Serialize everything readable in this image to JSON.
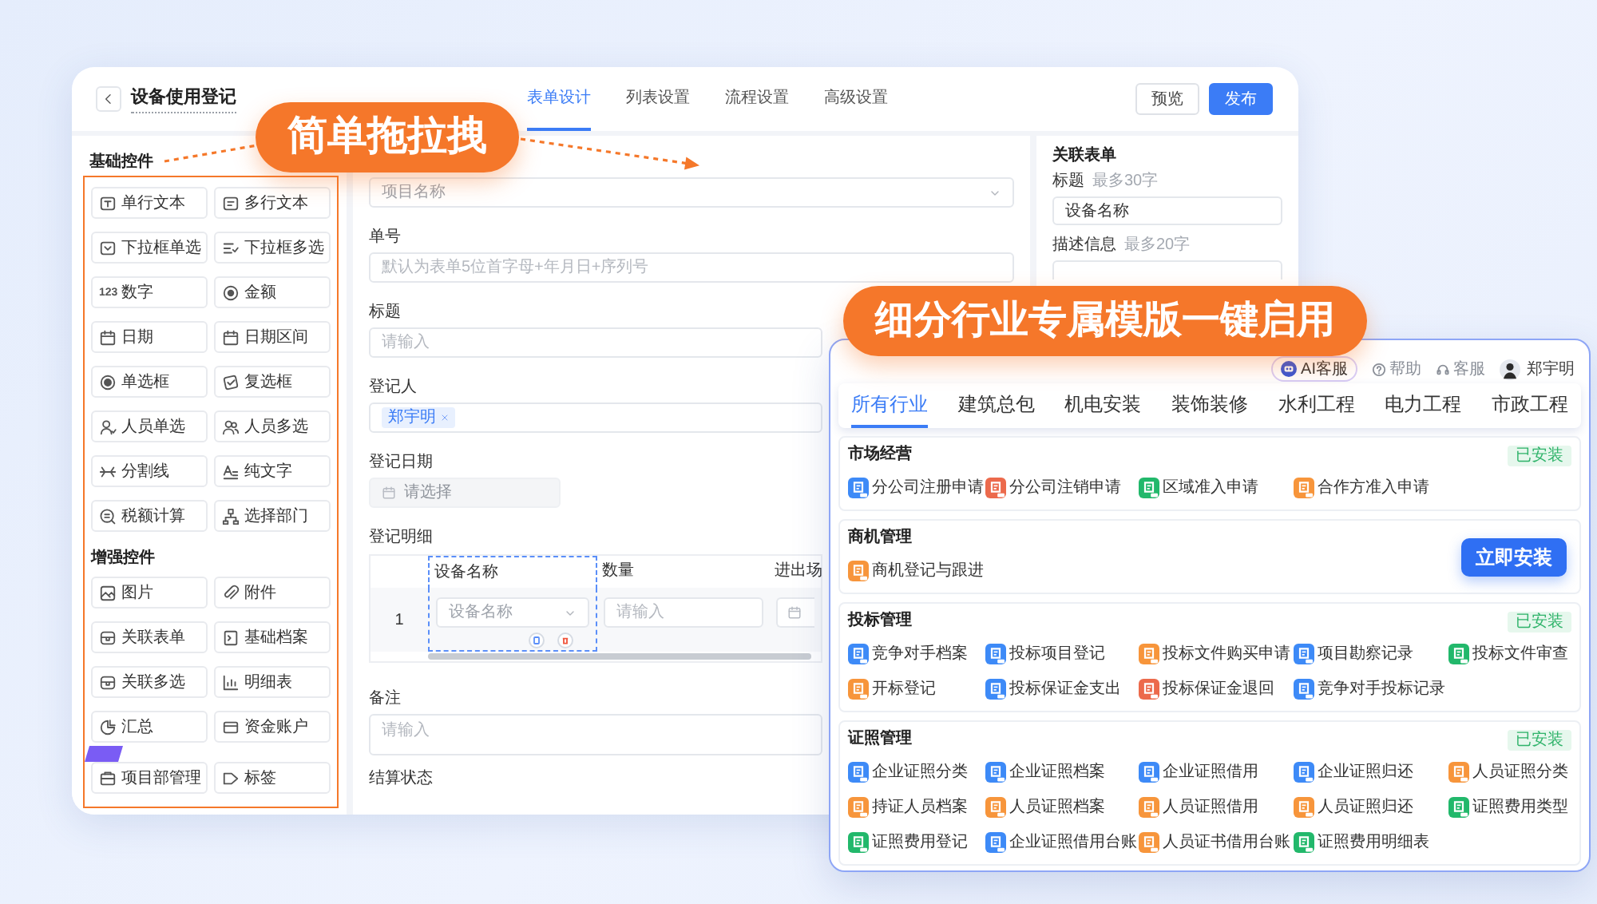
{
  "editor": {
    "title": "设备使用登记",
    "tabs": [
      {
        "label": "表单设计",
        "selected": true
      },
      {
        "label": "列表设置",
        "selected": false
      },
      {
        "label": "流程设置",
        "selected": false
      },
      {
        "label": "高级设置",
        "selected": false
      }
    ],
    "buttons": [
      {
        "label": "预览",
        "kind": "secondary"
      },
      {
        "label": "发布",
        "kind": "primary"
      }
    ],
    "palette": [
      {
        "title": "基础控件",
        "items": [
          {
            "label": "单行文本"
          },
          {
            "label": "多行文本"
          },
          {
            "label": "下拉框单选"
          },
          {
            "label": "下拉框多选"
          },
          {
            "label": "数字",
            "glyph": "123"
          },
          {
            "label": "金额"
          },
          {
            "label": "日期"
          },
          {
            "label": "日期区间"
          },
          {
            "label": "单选框"
          },
          {
            "label": "复选框"
          },
          {
            "label": "人员单选"
          },
          {
            "label": "人员多选"
          },
          {
            "label": "分割线"
          },
          {
            "label": "纯文字"
          },
          {
            "label": "税额计算"
          },
          {
            "label": "选择部门"
          }
        ]
      },
      {
        "title": "增强控件",
        "items": [
          {
            "label": "图片"
          },
          {
            "label": "附件"
          },
          {
            "label": "关联表单"
          },
          {
            "label": "基础档案"
          },
          {
            "label": "关联多选"
          },
          {
            "label": "明细表"
          },
          {
            "label": "汇总"
          },
          {
            "label": "资金账户"
          },
          {
            "label": "项目部管理",
            "badge": true
          },
          {
            "label": "标签"
          }
        ]
      }
    ],
    "form": [
      {
        "kind": "select",
        "placeholder": "项目名称"
      },
      {
        "kind": "input",
        "label": "单号",
        "placeholder": "默认为表单5位首字母+年月日+序列号"
      },
      {
        "kind": "input",
        "label": "标题",
        "placeholder": "请输入"
      },
      {
        "kind": "people",
        "label": "登记人",
        "tags": [
          "郑宇明"
        ]
      },
      {
        "kind": "date",
        "label": "登记日期",
        "placeholder": "请选择",
        "disabled": true
      },
      {
        "kind": "table",
        "label": "登记明细",
        "columns": [
          {
            "title": "设备名称",
            "selected": true
          },
          {
            "title": "数量",
            "selected": false
          },
          {
            "title": "进出场",
            "selected": false
          }
        ],
        "rows": [
          {
            "number": "1",
            "cells": [
              {
                "kind": "select",
                "placeholder": "设备名称"
              },
              {
                "kind": "input",
                "placeholder": "请输入"
              },
              {
                "kind": "date"
              }
            ]
          }
        ]
      },
      {
        "kind": "textarea",
        "label": "备注",
        "placeholder": "请输入"
      },
      {
        "kind": "heading",
        "label": "结算状态"
      }
    ],
    "properties": {
      "title": "关联表单",
      "fields": [
        {
          "kind": "input",
          "label": "标题",
          "hint": "最多30字",
          "value": "设备名称"
        },
        {
          "kind": "textarea",
          "label": "描述信息",
          "hint": "最多20字"
        }
      ]
    }
  },
  "callouts": [
    {
      "text": "简单拖拉拽"
    },
    {
      "text": "细分行业专属模版一键启用"
    }
  ],
  "templates": {
    "ai_button": "AI客服",
    "links": [
      "帮助",
      "客服"
    ],
    "user": "郑宇明",
    "tabs": [
      {
        "label": "所有行业",
        "selected": true
      },
      {
        "label": "建筑总包",
        "selected": false
      },
      {
        "label": "机电安装",
        "selected": false
      },
      {
        "label": "装饰装修",
        "selected": false
      },
      {
        "label": "水利工程",
        "selected": false
      },
      {
        "label": "电力工程",
        "selected": false
      },
      {
        "label": "市政工程",
        "selected": false
      }
    ],
    "sections": [
      {
        "title": "市场经营",
        "badge": "已安装",
        "items": [
          {
            "label": "分公司注册申请",
            "color": "#3d8af7"
          },
          {
            "label": "分公司注销申请",
            "color": "#ec6a4c"
          },
          {
            "label": "区域准入申请",
            "color": "#22b86b"
          },
          {
            "label": "合作方准入申请",
            "color": "#f7953b"
          }
        ]
      },
      {
        "title": "商机管理",
        "action": "立即安装",
        "items": [
          {
            "label": "商机登记与跟进",
            "color": "#f7953b"
          }
        ]
      },
      {
        "title": "投标管理",
        "badge": "已安装",
        "items": [
          {
            "label": "竞争对手档案",
            "color": "#3d8af7"
          },
          {
            "label": "投标项目登记",
            "color": "#3d8af7"
          },
          {
            "label": "投标文件购买申请",
            "color": "#f7953b"
          },
          {
            "label": "项目勘察记录",
            "color": "#3d8af7"
          },
          {
            "label": "投标文件审查",
            "color": "#22b86b"
          },
          {
            "label": "开标登记",
            "color": "#f7953b"
          },
          {
            "label": "投标保证金支出",
            "color": "#3d8af7"
          },
          {
            "label": "投标保证金退回",
            "color": "#ec6a4c"
          },
          {
            "label": "竞争对手投标记录",
            "color": "#3d8af7"
          }
        ]
      },
      {
        "title": "证照管理",
        "badge": "已安装",
        "items": [
          {
            "label": "企业证照分类",
            "color": "#3d8af7"
          },
          {
            "label": "企业证照档案",
            "color": "#3d8af7"
          },
          {
            "label": "企业证照借用",
            "color": "#3d8af7"
          },
          {
            "label": "企业证照归还",
            "color": "#3d8af7"
          },
          {
            "label": "人员证照分类",
            "color": "#f7953b"
          },
          {
            "label": "持证人员档案",
            "color": "#f7953b"
          },
          {
            "label": "人员证照档案",
            "color": "#f7953b"
          },
          {
            "label": "人员证照借用",
            "color": "#f7953b"
          },
          {
            "label": "人员证照归还",
            "color": "#f7953b"
          },
          {
            "label": "证照费用类型",
            "color": "#22b86b"
          },
          {
            "label": "证照费用登记",
            "color": "#22b86b"
          },
          {
            "label": "企业证照借用台账",
            "color": "#3d8af7"
          },
          {
            "label": "人员证书借用台账",
            "color": "#f7953b"
          },
          {
            "label": "证照费用明细表",
            "color": "#22b86b"
          }
        ]
      }
    ]
  }
}
